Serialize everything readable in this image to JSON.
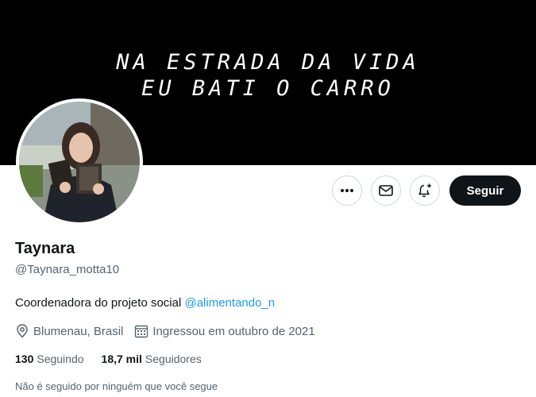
{
  "banner": {
    "line1": "NA ESTRADA DA VIDA",
    "line2": "EU BATI O CARRO"
  },
  "actions": {
    "more_icon": "more-dots-icon",
    "message_icon": "envelope-icon",
    "notify_icon": "bell-plus-icon",
    "follow_label": "Seguir"
  },
  "profile": {
    "name": "Taynara",
    "handle": "@Taynara_motta10",
    "bio_text": "Coordenadora do projeto social ",
    "bio_mention": "@alimentando_n",
    "location": "Blumenau, Brasil",
    "joined": "Ingressou em outubro de 2021",
    "location_icon": "location-pin-icon",
    "calendar_icon": "calendar-icon"
  },
  "stats": {
    "following_count": "130",
    "following_label": "Seguindo",
    "followers_count": "18,7 mil",
    "followers_label": "Seguidores"
  },
  "followers_note": "Não é seguido por ninguém que você segue",
  "colors": {
    "accent": "#1d9bf0",
    "text": "#0f1419",
    "secondary": "#536471",
    "banner": "#000000"
  }
}
